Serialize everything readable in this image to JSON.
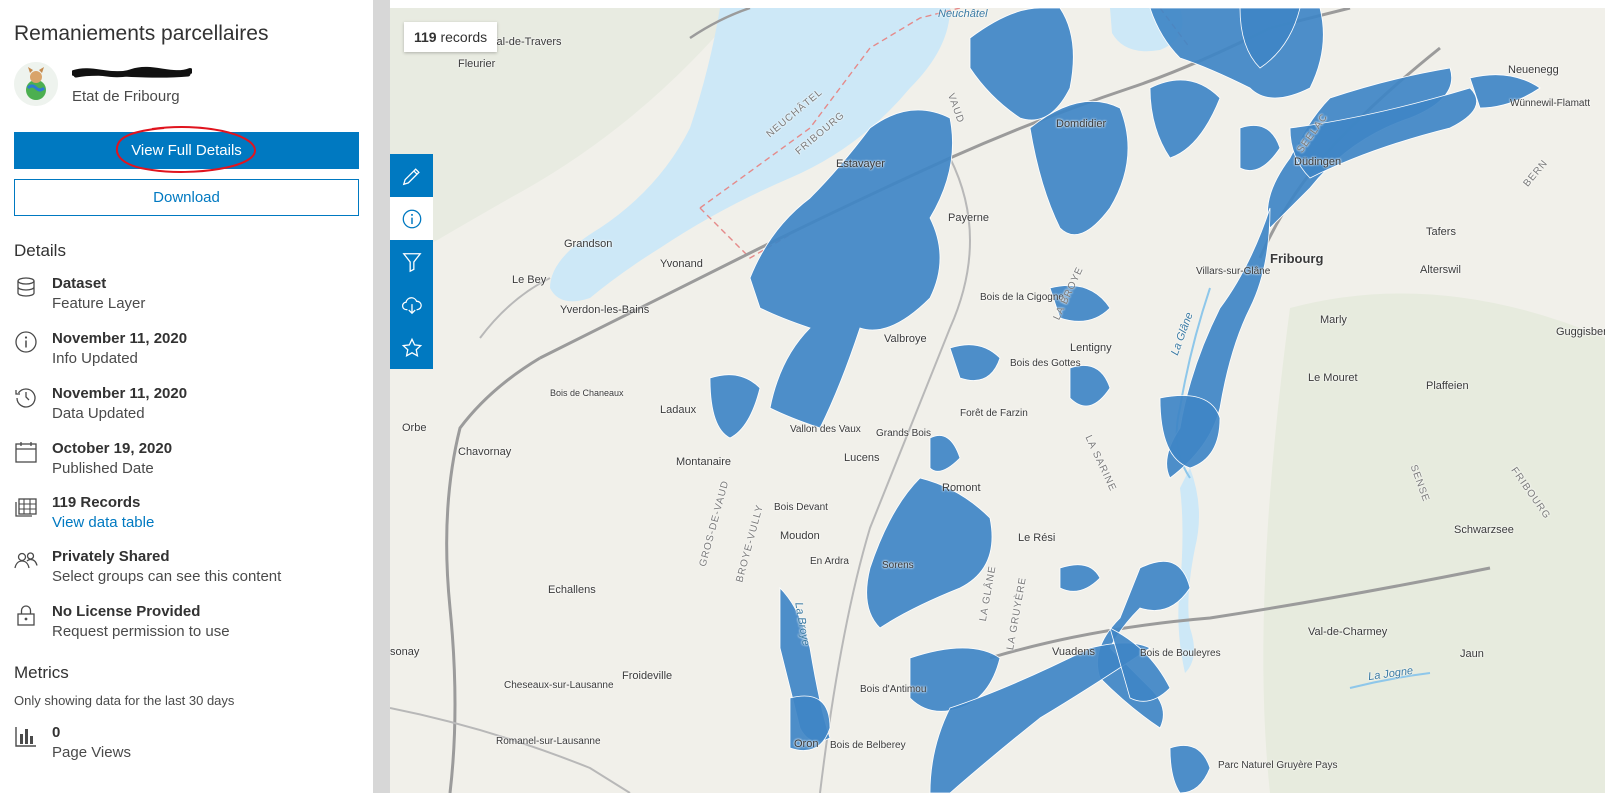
{
  "panel": {
    "title": "Remaniements parcellaires",
    "owner_org": "Etat de Fribourg",
    "view_full_details_label": "View Full Details",
    "download_label": "Download",
    "details_heading": "Details",
    "details": [
      {
        "icon": "database-icon",
        "title": "Dataset",
        "subtitle": "Feature Layer"
      },
      {
        "icon": "info-icon",
        "title": "November 11, 2020",
        "subtitle": "Info Updated"
      },
      {
        "icon": "history-icon",
        "title": "November 11, 2020",
        "subtitle": "Data Updated"
      },
      {
        "icon": "calendar-icon",
        "title": "October 19, 2020",
        "subtitle": "Published Date"
      },
      {
        "icon": "table-icon",
        "title": "119 Records",
        "subtitle": "View data table"
      },
      {
        "icon": "users-icon",
        "title": "Privately Shared",
        "subtitle": "Select groups can see this content"
      },
      {
        "icon": "lock-icon",
        "title": "No License Provided",
        "subtitle": "Request permission to use"
      }
    ],
    "metrics_heading": "Metrics",
    "metrics_note": "Only showing data for the last 30 days",
    "page_views": {
      "value": "0",
      "label": "Page Views"
    }
  },
  "map": {
    "records_count": "119",
    "records_label": "records",
    "tools": [
      "edit-icon",
      "info-icon",
      "filter-icon",
      "cloud-download-icon",
      "star-icon"
    ],
    "places": [
      "Neuchâtel",
      "Val-de-Travers",
      "Fleurier",
      "NEUCHÂTEL",
      "FRIBOURG",
      "VAUD",
      "Estavayer",
      "Payerne",
      "Grandson",
      "Yvonand",
      "Le Bey",
      "Yverdon-les-Bains",
      "Orbe",
      "Chavornay",
      "Bois de Chaneaux",
      "Ladaux",
      "Montanaire",
      "Lucens",
      "Grands Bois",
      "Vallon des Vaux",
      "Romont",
      "Moudon",
      "Bois Devant",
      "En Ardra",
      "Echallens",
      "Froideville",
      "Cheseaux-sur-Lausanne",
      "Romanel-sur-Lausanne",
      "Oron",
      "Bois de Belberey",
      "Fribourg",
      "Düdingen",
      "Tafers",
      "Alterswil",
      "Marly",
      "Le Mouret",
      "Plaffeien",
      "Schwarzsee",
      "Val-de-Charmey",
      "Jaun",
      "Lentigny",
      "Le Rési",
      "Forêt de Farzin",
      "Bois des Gottes",
      "Bois de la Cigogne",
      "Valbroye",
      "Domdidier",
      "Neuenegg",
      "Wünnewil-Flamatt",
      "Guggisberg",
      "Vuadens",
      "Bois de Bouleyres",
      "Villars-sur-Glâne",
      "SENSE",
      "SEELAC",
      "BERN",
      "LA BROYE",
      "LA SARINE",
      "LA GRUYÈRE",
      "LA GLÂNE",
      "GROS-DE-VAUD",
      "BROYE-VULLY",
      "FRIBOURG",
      "La Broye",
      "La Glâne",
      "La Jogne",
      "Sorens",
      "sonay",
      "Bois d'Antimou",
      "Parc Naturel Gruyère Pays"
    ],
    "layer_color": "#3f86c6"
  }
}
